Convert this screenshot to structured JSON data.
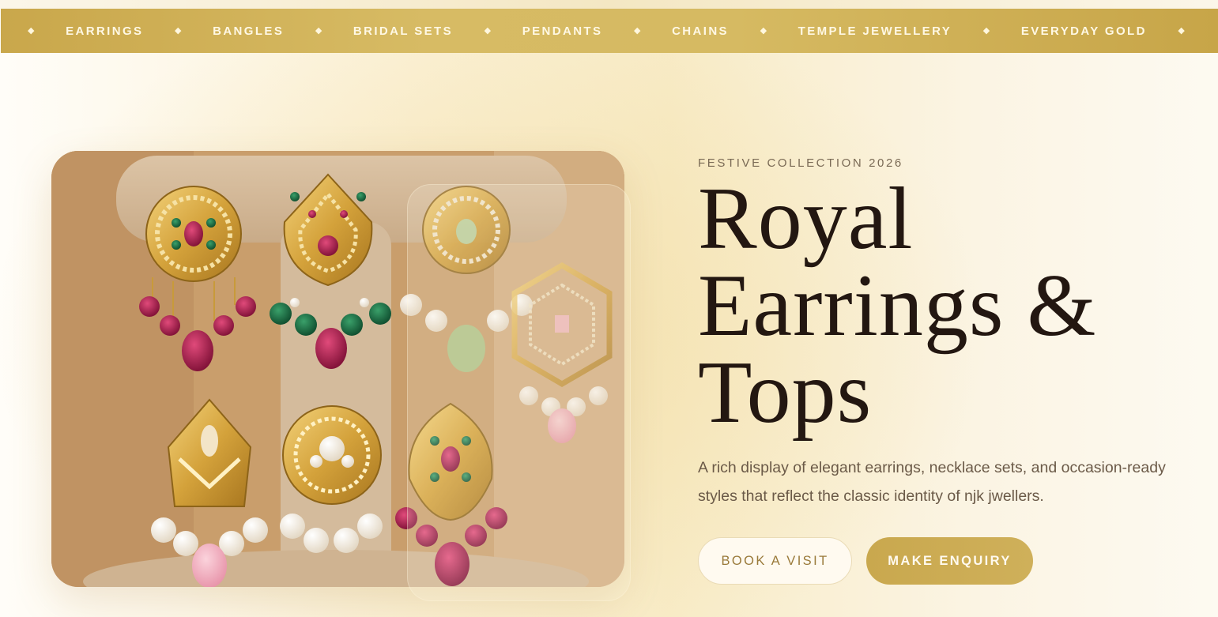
{
  "category_nav": {
    "items": [
      {
        "label": "EARRINGS"
      },
      {
        "label": "BANGLES"
      },
      {
        "label": "BRIDAL SETS"
      },
      {
        "label": "PENDANTS"
      },
      {
        "label": "CHAINS"
      },
      {
        "label": "TEMPLE JEWELLERY"
      },
      {
        "label": "EVERYDAY GOLD"
      }
    ],
    "separator_icon": "diamond-icon",
    "separator_glyph": "◆"
  },
  "hero": {
    "eyebrow": "FESTIVE COLLECTION 2026",
    "headline_lines": [
      "Royal",
      "Earrings &",
      "Tops"
    ],
    "description": "A rich display of elegant earrings, necklace sets, and occasion-ready styles that reflect the classic identity of njk jwellers.",
    "primary_button": "BOOK A VISIT",
    "secondary_button": "MAKE ENQUIRY"
  },
  "colors": {
    "gold_bar": "#d2b45c",
    "heading": "#231711",
    "body_text": "#6b5a48",
    "button_gold": "#cba953"
  }
}
